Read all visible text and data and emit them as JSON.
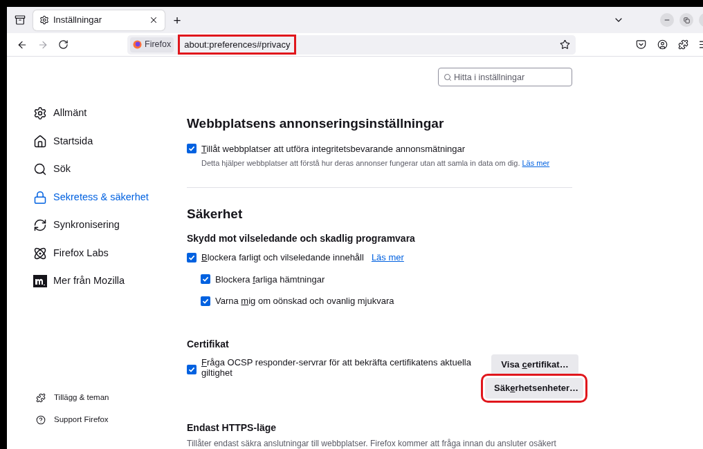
{
  "tab": {
    "title": "Inställningar",
    "selected": true
  },
  "new_tab": "+",
  "nav": {
    "forward_disabled": true
  },
  "url_bar": {
    "identity": "Firefox",
    "url": "about:preferences#privacy",
    "highlighted": true
  },
  "search": {
    "placeholder": "Hitta i inställningar"
  },
  "sidebar": {
    "items": [
      {
        "label": "Allmänt",
        "selected": false
      },
      {
        "label": "Startsida",
        "selected": false
      },
      {
        "label": "Sök",
        "selected": false
      },
      {
        "label": "Sekretess & säkerhet",
        "selected": true
      },
      {
        "label": "Synkronisering",
        "selected": false
      },
      {
        "label": "Firefox Labs",
        "selected": false
      },
      {
        "label": "Mer från Mozilla",
        "selected": false
      }
    ],
    "footer": [
      {
        "label": "Tillägg & teman"
      },
      {
        "label": "Support Firefox"
      }
    ]
  },
  "ads": {
    "heading": "Webbplatsens annonseringsinställningar",
    "option": {
      "key": "T",
      "post": "illåt webbplatser att utföra integritetsbevarande annonsmätningar",
      "checked": true
    },
    "description": "Detta hjälper webbplatser att förstå hur deras annonser fungerar utan att samla in data om dig.",
    "link": "Läs mer"
  },
  "security": {
    "heading": "Säkerhet",
    "subheading": "Skydd mot vilseledande och skadlig programvara",
    "options": [
      {
        "key": "B",
        "post": "lockera farligt och vilseledande innehåll",
        "checked": true,
        "link": "Läs mer",
        "children": [
          {
            "pre": "Blockera ",
            "key": "f",
            "post": "arliga hämtningar",
            "checked": true
          },
          {
            "pre": "Varna ",
            "key": "m",
            "post": "ig om oönskad och ovanlig mjukvara",
            "checked": true
          }
        ]
      }
    ]
  },
  "certificates": {
    "heading": "Certifikat",
    "option": {
      "key": "F",
      "post": "råga OCSP responder-servrar för att bekräfta certifikatens aktuella giltighet",
      "checked": true
    },
    "buttons": [
      {
        "pre": "Visa ",
        "key": "c",
        "post": "ertifikat…",
        "highlighted": false
      },
      {
        "pre": "Säk",
        "key": "e",
        "post": "rhetsenheter…",
        "highlighted": true
      }
    ]
  },
  "https_only": {
    "heading": "Endast HTTPS-läge",
    "description": "Tillåter endast säkra anslutningar till webbplatser. Firefox kommer att fråga innan du ansluter osäkert"
  }
}
